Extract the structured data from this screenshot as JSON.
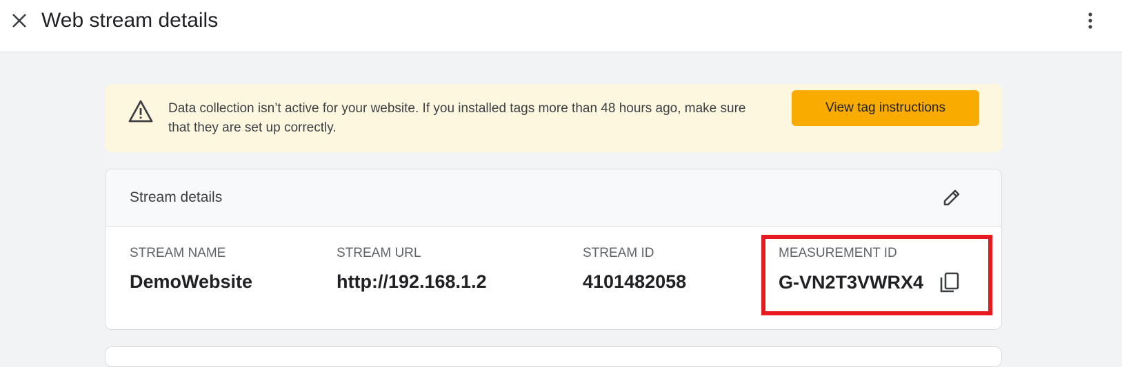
{
  "header": {
    "title": "Web stream details",
    "close_icon": "close-icon",
    "more_icon": "more-vert-icon"
  },
  "banner": {
    "icon": "warning-icon",
    "message": "Data collection isn’t active for your website. If you installed tags more than 48 hours ago, make sure that they are set up correctly.",
    "button_label": "View tag instructions",
    "background_color": "#fef7e0",
    "button_color": "#f9ab00"
  },
  "stream_details": {
    "title": "Stream details",
    "edit_icon": "pencil-icon",
    "fields": [
      {
        "label": "STREAM NAME",
        "value": "DemoWebsite"
      },
      {
        "label": "STREAM URL",
        "value": "http://192.168.1.2"
      },
      {
        "label": "STREAM ID",
        "value": "4101482058"
      },
      {
        "label": "MEASUREMENT ID",
        "value": "G-VN2T3VWRX4",
        "action_icon": "copy-icon"
      }
    ],
    "highlight_color": "#e8191f"
  }
}
